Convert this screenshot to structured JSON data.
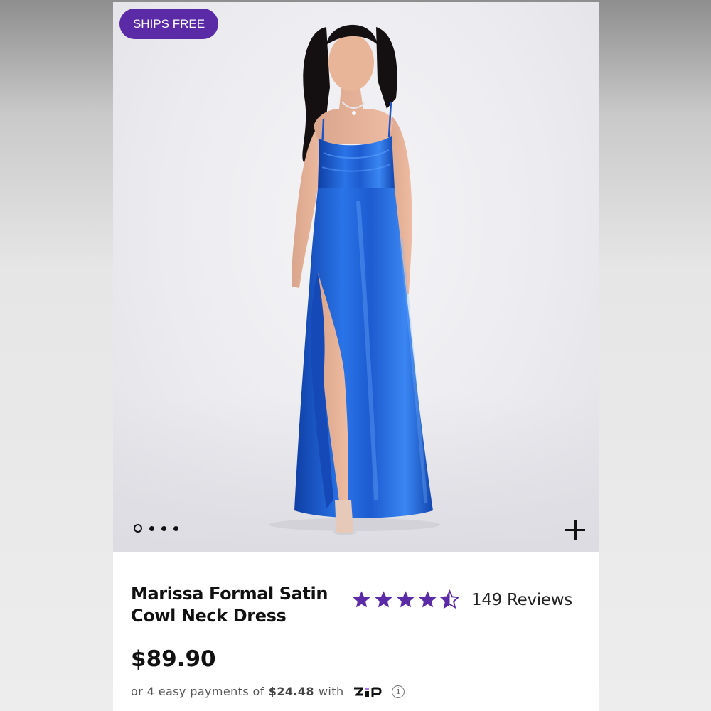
{
  "badge": {
    "label": "SHIPS FREE"
  },
  "gallery": {
    "image_count": 4,
    "active_index": 0
  },
  "product": {
    "title_line1": "Marissa Formal Satin",
    "title_line2": "Cowl Neck Dress",
    "rating": 4.5,
    "reviews_label": "149 Reviews",
    "price": "$89.90",
    "installment_prefix": "or 4 easy payments of",
    "installment_amount": "$24.48",
    "installment_suffix": "with",
    "payment_provider": "zip"
  },
  "colors": {
    "badge_purple": "#5b2aa6",
    "star_purple": "#5b2aa6",
    "dress_blue": "#1f5fd6"
  },
  "icons": {
    "zoom": "plus-icon",
    "info": "info-icon",
    "star": "star-icon"
  }
}
